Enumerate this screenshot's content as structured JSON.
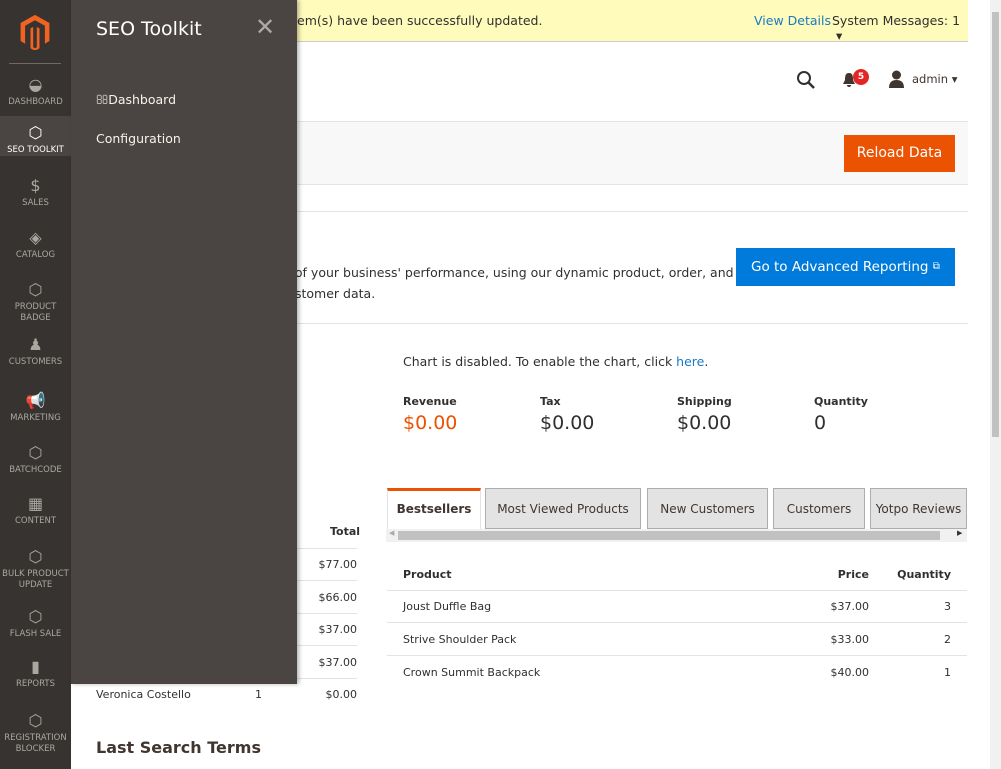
{
  "nav": {
    "items": [
      {
        "label": "Dashboard",
        "icon": "dashboard-icon"
      },
      {
        "label": "SEO Toolkit",
        "icon": "hexagon-icon",
        "active": true
      },
      {
        "label": "Sales",
        "icon": "dollar-icon"
      },
      {
        "label": "Catalog",
        "icon": "box-icon"
      },
      {
        "label": "Product Badge",
        "icon": "hexagon-icon"
      },
      {
        "label": "Customers",
        "icon": "person-icon"
      },
      {
        "label": "Marketing",
        "icon": "megaphone-icon"
      },
      {
        "label": "Batchcode",
        "icon": "hexagon-icon"
      },
      {
        "label": "Content",
        "icon": "layout-icon"
      },
      {
        "label": "Bulk Product Update",
        "icon": "hexagon-icon"
      },
      {
        "label": "Flash Sale",
        "icon": "hexagon-icon"
      },
      {
        "label": "Reports",
        "icon": "bar-chart-icon"
      },
      {
        "label": "Registration Blocker",
        "icon": "hexagon-icon"
      }
    ]
  },
  "flyout": {
    "title": "SEO Toolkit",
    "items": [
      "Dashboard",
      "Configuration"
    ]
  },
  "message": {
    "text": "em(s) have been successfully updated.",
    "view_details": "View Details",
    "system_messages": "System Messages: 1"
  },
  "header": {
    "notifications": "5",
    "user": "admin"
  },
  "actions": {
    "reload": "Reload Data"
  },
  "intro": {
    "line1": "d of your business' performance, using our dynamic product, order, and",
    "line2": "stomer data.",
    "button": "Go to Advanced Reporting"
  },
  "chart_notice": {
    "text": "Chart is disabled. To enable the chart, click ",
    "link": "here",
    "end": "."
  },
  "totals": [
    {
      "label": "Revenue",
      "value": "$0.00"
    },
    {
      "label": "Tax",
      "value": "$0.00"
    },
    {
      "label": "Shipping",
      "value": "$0.00"
    },
    {
      "label": "Quantity",
      "value": "0"
    }
  ],
  "orders": {
    "total_header": "Total",
    "rows": [
      {
        "total": "$77.00"
      },
      {
        "total": "$66.00"
      },
      {
        "total": "$37.00"
      },
      {
        "total": "$37.00"
      },
      {
        "customer": "Veronica Costello",
        "items": "1",
        "total": "$0.00"
      }
    ]
  },
  "tabs": [
    "Bestsellers",
    "Most Viewed Products",
    "New Customers",
    "Customers",
    "Yotpo Reviews"
  ],
  "bestsellers": {
    "headers": [
      "Product",
      "Price",
      "Quantity"
    ],
    "rows": [
      [
        "Joust Duffle Bag",
        "$37.00",
        "3"
      ],
      [
        "Strive Shoulder Pack",
        "$33.00",
        "2"
      ],
      [
        "Crown Summit Backpack",
        "$40.00",
        "1"
      ]
    ]
  },
  "search_terms": {
    "title": "Last Search Terms"
  },
  "colors": {
    "accent": "#eb5202",
    "link": "#1979c3",
    "nav": "#373330"
  }
}
